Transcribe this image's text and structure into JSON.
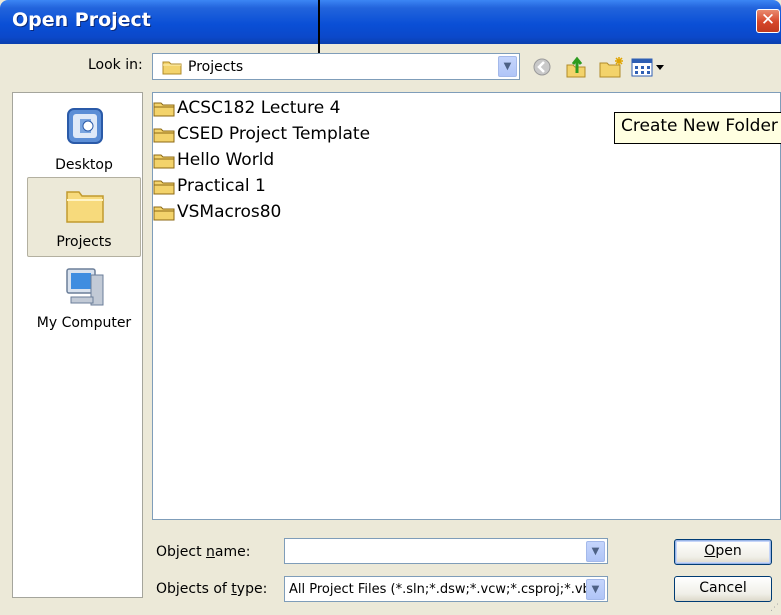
{
  "window": {
    "title": "Open Project",
    "close_label": "✕"
  },
  "toolbar": {
    "look_in_label": "Look in:",
    "look_in_value": "Projects",
    "back_icon": "back-arrow-icon",
    "up_icon": "up-one-level-icon",
    "new_folder_icon": "new-folder-icon",
    "views_icon": "views-menu-icon"
  },
  "places": [
    {
      "label": "Desktop",
      "icon": "desktop-icon",
      "selected": false
    },
    {
      "label": "Projects",
      "icon": "folder-icon",
      "selected": true
    },
    {
      "label": "My Computer",
      "icon": "my-computer-icon",
      "selected": false
    }
  ],
  "files": [
    {
      "name": "ACSC182 Lecture 4",
      "icon": "folder-icon"
    },
    {
      "name": "CSED Project Template",
      "icon": "folder-icon"
    },
    {
      "name": "Hello World",
      "icon": "folder-icon"
    },
    {
      "name": "Practical 1",
      "icon": "folder-icon"
    },
    {
      "name": "VSMacros80",
      "icon": "folder-icon"
    }
  ],
  "tooltip": "Create New Folder",
  "form": {
    "object_name_label_pre": "Object ",
    "object_name_label_ul": "n",
    "object_name_label_post": "ame:",
    "object_name_value": "",
    "type_label_pre": "Objects of ",
    "type_label_ul": "t",
    "type_label_post": "ype:",
    "type_value": "All Project Files (*.sln;*.dsw;*.vcw;*.csproj;*.vbp"
  },
  "buttons": {
    "open_ul": "O",
    "open_rest": "pen",
    "cancel": "Cancel"
  },
  "colors": {
    "title_bar": "#0b48c9",
    "dialog_bg": "#ece9d8",
    "tooltip_bg": "#ffffe1",
    "folder": "#f3d36b"
  }
}
